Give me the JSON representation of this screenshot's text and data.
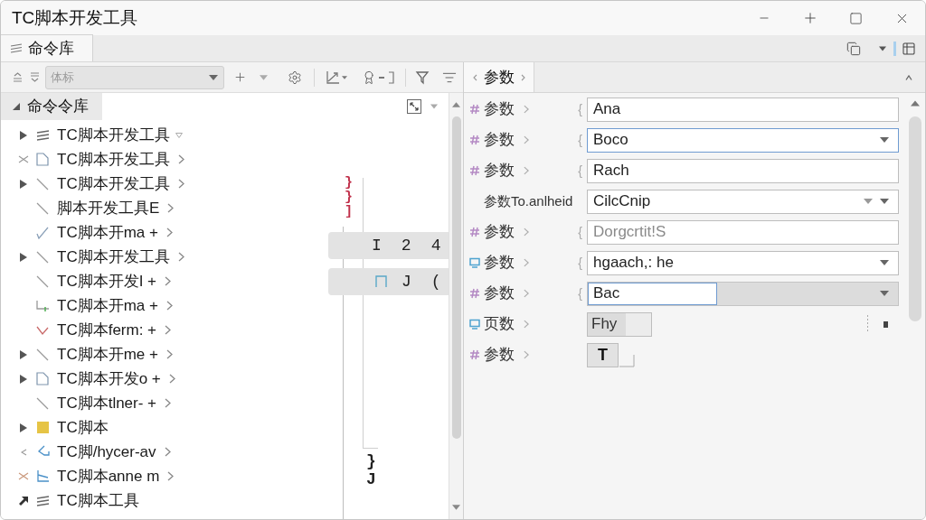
{
  "window": {
    "title": "TC脚本开发工具"
  },
  "tabs": [
    {
      "label": "命令库",
      "selected": true
    }
  ],
  "library_toolbar": {
    "search": {
      "placeholder": "体标"
    }
  },
  "tree": {
    "header": {
      "label": "命令令库",
      "expanded": true
    },
    "items": [
      {
        "label": "TC脚本开发工具",
        "kind": "list",
        "expanded": false,
        "trailing": {
          "kind": "caret"
        }
      },
      {
        "label": "TC脚本开发工具",
        "kind": "cut-page",
        "trailing": {
          "kind": "chevron"
        }
      },
      {
        "label": "TC脚本开发工具",
        "kind": "line",
        "expanded": false,
        "trailing": {
          "kind": "chevron"
        }
      },
      {
        "label": "脚本开发工具E",
        "kind": "line",
        "trailing": {
          "kind": "chevron"
        }
      },
      {
        "label": "TC脚本开ma +",
        "kind": "check",
        "trailing": {
          "kind": "chevron"
        }
      },
      {
        "label": "TC脚本开发工具",
        "kind": "line",
        "expanded": false,
        "trailing": {
          "kind": "chevron"
        }
      },
      {
        "label": "TC脚本开发I +",
        "kind": "line",
        "trailing": {
          "kind": "chevron"
        }
      },
      {
        "label": "TC脚本开ma +",
        "kind": "bracket",
        "trailing": {
          "kind": "chevron"
        }
      },
      {
        "label": "TC脚本ferm: +",
        "kind": "fork",
        "trailing": {
          "kind": "chevron"
        }
      },
      {
        "label": "TC脚本开me +",
        "kind": "line",
        "expanded": false,
        "trailing": {
          "kind": "chevron"
        }
      },
      {
        "label": "TC脚本开发o +",
        "kind": "page",
        "expanded": false,
        "trailing": {
          "kind": "chevron"
        }
      },
      {
        "label": "TC脚本tlner- +",
        "kind": "line",
        "trailing": {
          "kind": "chevron"
        }
      },
      {
        "label": "TC脚本",
        "kind": "folder",
        "expanded": false
      },
      {
        "label": "TC脚/hycer-av",
        "kind": "hook",
        "trailing": {
          "kind": "chevron"
        }
      },
      {
        "label": "TC脚本anne m",
        "kind": "cut-link",
        "trailing": {
          "kind": "chevron"
        }
      },
      {
        "label": "TC脚本工具",
        "kind": "pin"
      }
    ]
  },
  "outline": {
    "marks": [
      "}",
      "}",
      "]"
    ],
    "bars": [
      {
        "kind": "plain",
        "texts": [
          "I",
          "2",
          "4"
        ]
      },
      {
        "kind": "square",
        "texts": [
          "J",
          "("
        ]
      }
    ],
    "closing_marks": [
      "}",
      "J"
    ]
  },
  "params": {
    "tab": {
      "label": "参数"
    },
    "rows": [
      {
        "icon": {
          "kind": "hash"
        },
        "label": "参数",
        "chevron": true,
        "prefix": "{",
        "kind": "text",
        "value": "Ana",
        "focused": false
      },
      {
        "icon": {
          "kind": "hash"
        },
        "label": "参数",
        "chevron": true,
        "prefix": "{",
        "kind": "dropdown",
        "value": "Boco",
        "focused": true
      },
      {
        "icon": {
          "kind": "hash"
        },
        "label": "参数",
        "chevron": true,
        "prefix": "{",
        "kind": "text",
        "value": "Rach",
        "focused": false
      },
      {
        "label": "参数To.anlheid",
        "chevron": false,
        "kind": "double-dropdown",
        "value": "CilcCnip",
        "focused": false
      },
      {
        "icon": {
          "kind": "hash"
        },
        "label": "参数",
        "chevron": true,
        "prefix": "{",
        "kind": "text",
        "placeholder": "Dorgcrtit!S",
        "focused": false
      },
      {
        "icon": {
          "kind": "frame"
        },
        "label": "参数",
        "chevron": true,
        "prefix": "{",
        "kind": "dropdown",
        "value": "hgaach,: he",
        "focused": false
      },
      {
        "icon": {
          "kind": "hash"
        },
        "label": "参数",
        "chevron": true,
        "prefix": "{",
        "kind": "combo",
        "value": "Bac",
        "focused": true
      },
      {
        "icon": {
          "kind": "frame"
        },
        "label": "页数",
        "chevron": true,
        "kind": "short",
        "value": "Fhy",
        "focused": false
      },
      {
        "icon": {
          "kind": "hash"
        },
        "label": "参数",
        "chevron": true,
        "kind": "button",
        "value": "T",
        "focused": false
      }
    ]
  }
}
